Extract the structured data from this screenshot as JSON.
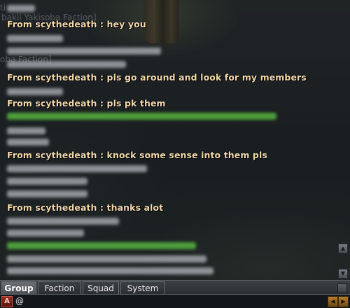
{
  "background": {
    "partial_labels": [
      "ti",
      "bakii Yakisoba Faction]",
      "oba Faction]"
    ]
  },
  "chat": {
    "lines": [
      {
        "text": "From scythedeath : hey you"
      },
      {
        "text": "From scythedeath : pls go around and look for my members"
      },
      {
        "text": "From scythedeath : pls pk them"
      },
      {
        "text": "From scythedeath : knock some sense into them pls"
      },
      {
        "text": "From scythedeath : thanks alot"
      }
    ],
    "text_color": "#f1d9ac",
    "faction_color": "#5fc846"
  },
  "tabs": [
    {
      "label": "Group",
      "active": true
    },
    {
      "label": "Faction",
      "active": false
    },
    {
      "label": "Squad",
      "active": false
    },
    {
      "label": "System",
      "active": false
    }
  ],
  "input": {
    "mode_icon": "A",
    "value": "@"
  },
  "icons": {
    "scroll_up": "triangle-up-icon",
    "scroll_down": "triangle-down-icon",
    "input_mode": "letter-a-icon"
  }
}
